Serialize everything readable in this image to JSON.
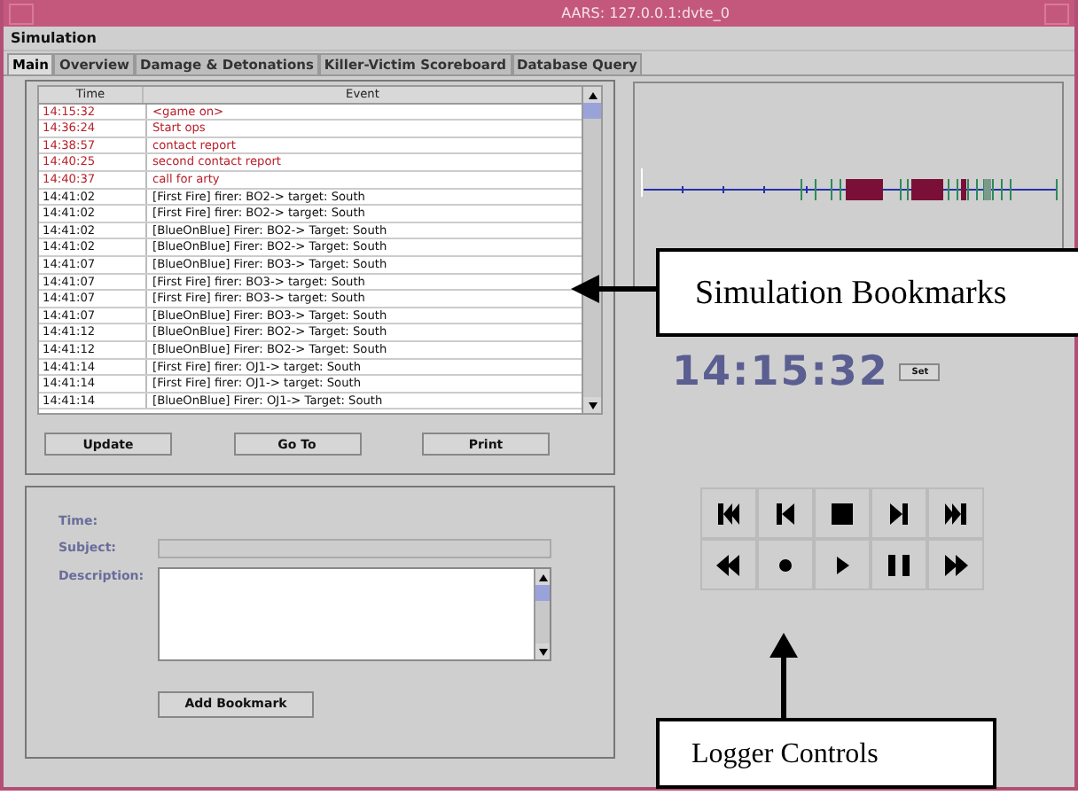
{
  "window": {
    "title": "AARS: 127.0.0.1:dvte_0"
  },
  "menu": [
    "Simulation"
  ],
  "tabs": [
    {
      "label": "Main",
      "selected": true
    },
    {
      "label": "Overview",
      "selected": false
    },
    {
      "label": "Damage & Detonations",
      "selected": false
    },
    {
      "label": "Killer-Victim Scoreboard",
      "selected": false
    },
    {
      "label": "Database Query",
      "selected": false
    }
  ],
  "table": {
    "columns": [
      "Time",
      "Event"
    ],
    "rows": [
      {
        "kind": "bookmark",
        "time": "14:15:32",
        "event": "<game on>"
      },
      {
        "kind": "bookmark",
        "time": "14:36:24",
        "event": "Start ops"
      },
      {
        "kind": "bookmark",
        "time": "14:38:57",
        "event": "contact report"
      },
      {
        "kind": "bookmark",
        "time": "14:40:25",
        "event": "second contact report"
      },
      {
        "kind": "bookmark",
        "time": "14:40:37",
        "event": "call for arty"
      },
      {
        "kind": "event",
        "time": "14:41:02",
        "event": "[First Fire] firer: BO2-> target: South"
      },
      {
        "kind": "event",
        "time": "14:41:02",
        "event": "[First Fire] firer: BO2-> target: South"
      },
      {
        "kind": "event",
        "time": "14:41:02",
        "event": "[BlueOnBlue] Firer: BO2-> Target: South"
      },
      {
        "kind": "event",
        "time": "14:41:02",
        "event": "[BlueOnBlue] Firer: BO2-> Target: South"
      },
      {
        "kind": "event",
        "time": "14:41:07",
        "event": "[BlueOnBlue] Firer: BO3-> Target: South"
      },
      {
        "kind": "event",
        "time": "14:41:07",
        "event": "[First Fire] firer: BO3-> target: South"
      },
      {
        "kind": "event",
        "time": "14:41:07",
        "event": "[First Fire] firer: BO3-> target: South"
      },
      {
        "kind": "event",
        "time": "14:41:07",
        "event": "[BlueOnBlue] Firer: BO3-> Target: South"
      },
      {
        "kind": "event",
        "time": "14:41:12",
        "event": "[BlueOnBlue] Firer: BO2-> Target: South"
      },
      {
        "kind": "event",
        "time": "14:41:12",
        "event": "[BlueOnBlue] Firer: BO2-> Target: South"
      },
      {
        "kind": "event",
        "time": "14:41:14",
        "event": "[First Fire] firer: OJ1-> target: South"
      },
      {
        "kind": "event",
        "time": "14:41:14",
        "event": "[First Fire] firer: OJ1-> target: South"
      },
      {
        "kind": "event",
        "time": "14:41:14",
        "event": "[BlueOnBlue] Firer: OJ1-> Target: South"
      }
    ]
  },
  "table_buttons": [
    "Update",
    "Go To",
    "Print"
  ],
  "bookmark_form": {
    "time_label": "Time:",
    "subject_label": "Subject:",
    "description_label": "Description:",
    "button": "Add Bookmark"
  },
  "clock": {
    "time": "14:15:32",
    "button": "Set"
  },
  "controls": [
    {
      "kind": "first"
    },
    {
      "kind": "previous"
    },
    {
      "kind": "stop"
    },
    {
      "kind": "next"
    },
    {
      "kind": "last"
    },
    {
      "kind": "rewind"
    },
    {
      "kind": "record"
    },
    {
      "kind": "play"
    },
    {
      "kind": "pause"
    },
    {
      "kind": "fast-forward"
    }
  ],
  "callouts": [
    {
      "kind": "left",
      "label": "Simulation Bookmarks"
    },
    {
      "kind": "up",
      "label": "Logger Controls"
    }
  ]
}
